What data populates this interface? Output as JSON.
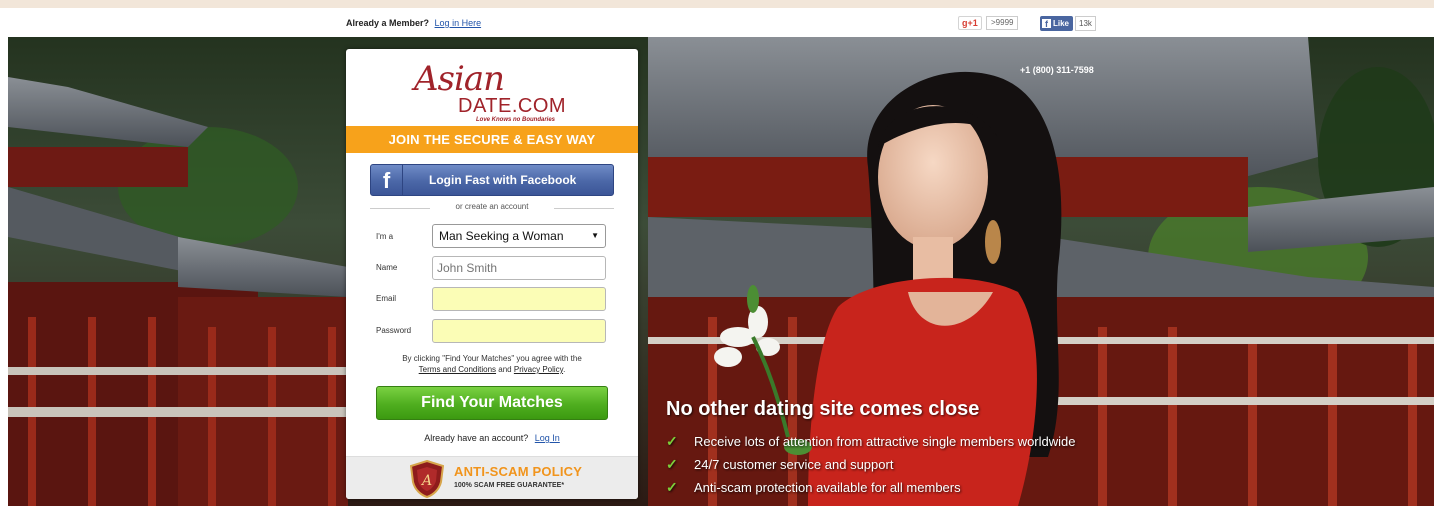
{
  "topbar": {
    "member_text": "Already a Member?",
    "login_link": "Log in Here",
    "gplus_label": "g+1",
    "gplus_count": ">9999",
    "fb_like_label": "Like",
    "fb_like_count": "13k"
  },
  "hero": {
    "phone": "+1 (800) 311-7598",
    "headline": "No other dating site comes close",
    "features": [
      "Receive lots of attention from attractive single members worldwide",
      "24/7 customer service and support",
      "Anti-scam protection available for all members"
    ]
  },
  "logo": {
    "brand_script": "Asian",
    "brand_main": "DATE.COM",
    "tagline": "Love Knows no Boundaries"
  },
  "form": {
    "join_banner": "JOIN THE SECURE & EASY WAY",
    "facebook_button": "Login Fast with Facebook",
    "divider_text": "or create an account",
    "im_a_label": "I'm a",
    "im_a_value": "Man Seeking a Woman",
    "name_label": "Name",
    "name_placeholder": "John Smith",
    "email_label": "Email",
    "email_value": "",
    "password_label": "Password",
    "password_value": "",
    "terms_prefix": "By clicking \"Find Your Matches\" you agree with the",
    "terms_link": "Terms and Conditions",
    "terms_and": "and",
    "privacy_link": "Privacy Policy",
    "terms_suffix": ".",
    "find_button": "Find Your Matches",
    "already_text": "Already have an account?",
    "login_link": "Log In"
  },
  "anti_scam": {
    "title": "ANTI-SCAM POLICY",
    "subtitle": "100% SCAM FREE GUARANTEE*"
  },
  "colors": {
    "brand_red": "#a0232a",
    "join_orange": "#f7a21b",
    "facebook_blue": "#4b67a7",
    "cta_green": "#4fae1f",
    "check_green": "#7ccf3a",
    "anti_scam_orange": "#f1941c"
  }
}
